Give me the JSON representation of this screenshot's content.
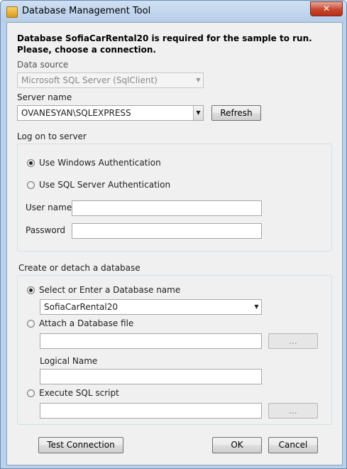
{
  "window": {
    "title": "Database Management Tool",
    "close_glyph": "✕"
  },
  "heading": "Database SofiaCarRental20 is required for the sample to run. Please, choose a connection.",
  "data_source": {
    "label": "Data source",
    "value": "Microsoft SQL Server (SqlClient)"
  },
  "server": {
    "label": "Server name",
    "value": "OVANESYAN\\SQLEXPRESS",
    "refresh_label": "Refresh"
  },
  "logon": {
    "label": "Log on to server",
    "windows_auth": "Use Windows Authentication",
    "sql_auth": "Use SQL Server Authentication",
    "selected": "windows",
    "user_name_label": "User name",
    "user_name_value": "",
    "password_label": "Password",
    "password_value": ""
  },
  "database": {
    "label": "Create or detach a database",
    "select_option": "Select or Enter a Database name",
    "db_name": "SofiaCarRental20",
    "attach_option": "Attach a Database file",
    "attach_file_value": "",
    "browse_label": "...",
    "logical_name_label": "Logical Name",
    "logical_name_value": "",
    "script_option": "Execute SQL script",
    "script_value": "",
    "selected": "select"
  },
  "buttons": {
    "test": "Test Connection",
    "ok": "OK",
    "cancel": "Cancel"
  },
  "icons": {
    "dropdown": "▼"
  }
}
